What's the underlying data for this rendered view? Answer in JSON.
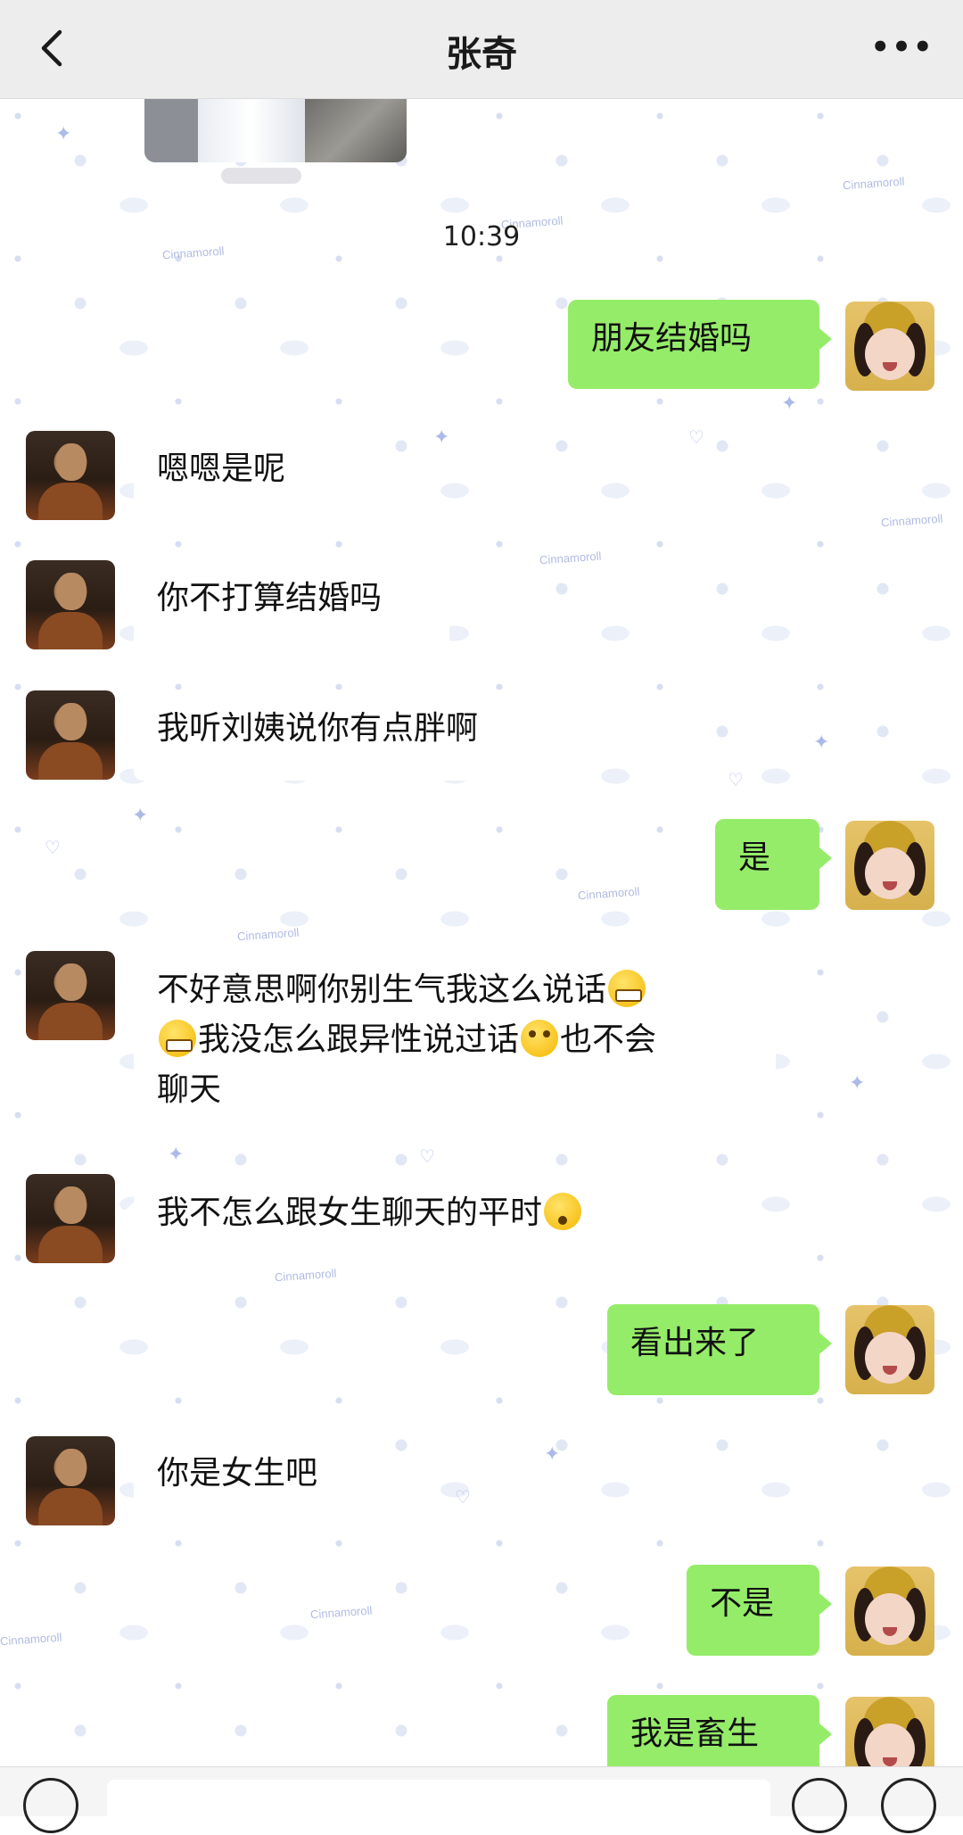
{
  "header": {
    "title": "张奇",
    "back_icon": "chevron-left-icon",
    "more_label": "•••"
  },
  "timestamp": "10:39",
  "wallpaper": {
    "brand_text": "Cinnamoroll"
  },
  "colors": {
    "self_bubble": "#95ec69",
    "other_bubble": "#ffffff",
    "header_bg": "#ededed"
  },
  "messages": [
    {
      "from": "self",
      "text": "朋友结婚吗"
    },
    {
      "from": "other",
      "text": "嗯嗯是呢"
    },
    {
      "from": "other",
      "text": "你不打算结婚吗"
    },
    {
      "from": "other",
      "text": "我听刘姨说你有点胖啊"
    },
    {
      "from": "self",
      "text": "是"
    },
    {
      "from": "other",
      "text_1": "不好意思啊你别生气我这么说话",
      "text_2": "我没怎么跟异性说过话",
      "text_3": "也不会",
      "text_4": "聊天"
    },
    {
      "from": "other",
      "text": "我不怎么跟女生聊天的平时"
    },
    {
      "from": "self",
      "text": "看出来了"
    },
    {
      "from": "other",
      "text": "你是女生吧"
    },
    {
      "from": "self",
      "text": "不是"
    },
    {
      "from": "self",
      "text": "我是畜生"
    }
  ]
}
